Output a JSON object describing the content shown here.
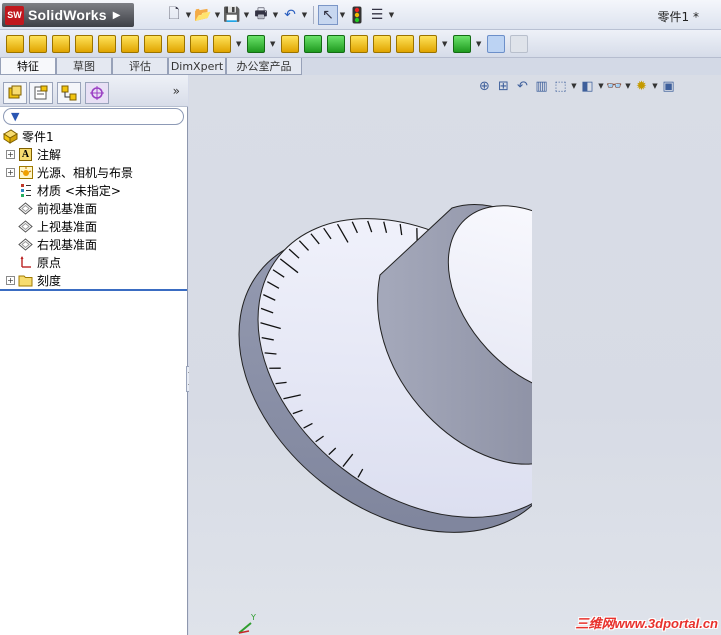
{
  "app": {
    "brand": "SolidWorks",
    "document_title": "零件1 *"
  },
  "tabs": [
    {
      "label": "特征",
      "active": true
    },
    {
      "label": "草图",
      "active": false
    },
    {
      "label": "评估",
      "active": false
    },
    {
      "label": "DimXpert",
      "active": false
    },
    {
      "label": "办公室产品",
      "active": false
    }
  ],
  "feature_tree": {
    "filter_icon": "filter-icon",
    "root": "零件1",
    "items": [
      {
        "label": "注解",
        "icon": "annotation-icon",
        "expandable": true
      },
      {
        "label": "光源、相机与布景",
        "icon": "lights-scene-icon",
        "expandable": true
      },
      {
        "label": "材质 <未指定>",
        "icon": "material-icon",
        "expandable": false
      },
      {
        "label": "前视基准面",
        "icon": "plane-icon",
        "expandable": false
      },
      {
        "label": "上视基准面",
        "icon": "plane-icon",
        "expandable": false
      },
      {
        "label": "右视基准面",
        "icon": "plane-icon",
        "expandable": false
      },
      {
        "label": "原点",
        "icon": "origin-icon",
        "expandable": false
      },
      {
        "label": "刻度",
        "icon": "folder-icon",
        "expandable": true
      }
    ]
  },
  "model": {
    "tick_count": 60
  },
  "triad": {
    "axis_label": "Y"
  },
  "watermark": "三维网www.3dportal.cn"
}
